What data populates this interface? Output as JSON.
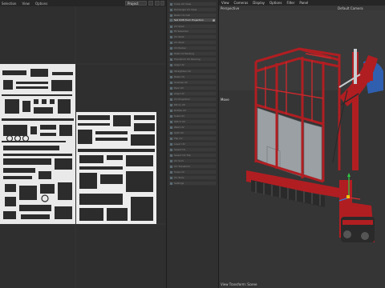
{
  "uv_editor": {
    "menu": [
      "Selection",
      "View",
      "Options"
    ],
    "dropdown_value": "Project"
  },
  "command_panel": {
    "items": [
      {
        "label": "Cube UV View",
        "active": false
      },
      {
        "label": "Rectangle UV View",
        "active": false
      },
      {
        "label": "Relax UV Cell",
        "active": false
      },
      {
        "label": "Set UVW from Projection",
        "active": true
      },
      {
        "label": "UV Shell",
        "active": false
      },
      {
        "label": "Fit Selection",
        "active": false
      },
      {
        "label": "UV Shell",
        "active": false
      },
      {
        "label": "UV Shell",
        "active": false
      },
      {
        "label": "UV Packer",
        "active": false
      },
      {
        "label": "Multi UV Packing",
        "active": false
      },
      {
        "label": "Transform UV Packing",
        "active": false
      },
      {
        "label": "Align UV",
        "active": false
      },
      {
        "label": "Straighten UV",
        "active": false
      },
      {
        "label": "Relax UV",
        "active": false
      },
      {
        "label": "Unwrap UV",
        "active": false
      },
      {
        "label": "Pack UV",
        "active": false
      },
      {
        "label": "Align UV",
        "active": false
      },
      {
        "label": "UV Projection",
        "active": false
      },
      {
        "label": "Mirror UV",
        "active": false
      },
      {
        "label": "Rotate UV",
        "active": false
      },
      {
        "label": "Scale UV",
        "active": false
      },
      {
        "label": "Stitch UV",
        "active": false
      },
      {
        "label": "Weld UV",
        "active": false
      },
      {
        "label": "Split UV",
        "active": false
      },
      {
        "label": "Flip UV",
        "active": false
      },
      {
        "label": "Layer UV",
        "active": false
      },
      {
        "label": "Select UV",
        "active": false
      },
      {
        "label": "Select UV Tile",
        "active": false
      },
      {
        "label": "UV Grid",
        "active": false
      },
      {
        "label": "UV Transform",
        "active": false
      },
      {
        "label": "Snap UV",
        "active": false
      },
      {
        "label": "UV Tools",
        "active": false
      },
      {
        "label": "Settings",
        "active": false
      }
    ]
  },
  "viewport": {
    "menu": [
      "View",
      "Cameras",
      "Display",
      "Options",
      "Filter",
      "Panel"
    ],
    "projection": "Perspective",
    "camera": "Default Camera",
    "tool_label": "Move",
    "status": "View Transform: Scene"
  },
  "colors": {
    "frame_red": "#b01e22",
    "panel_grey": "#9aa0a4",
    "track_dark": "#2a2a2a",
    "accent_blue": "#2f5fae"
  }
}
